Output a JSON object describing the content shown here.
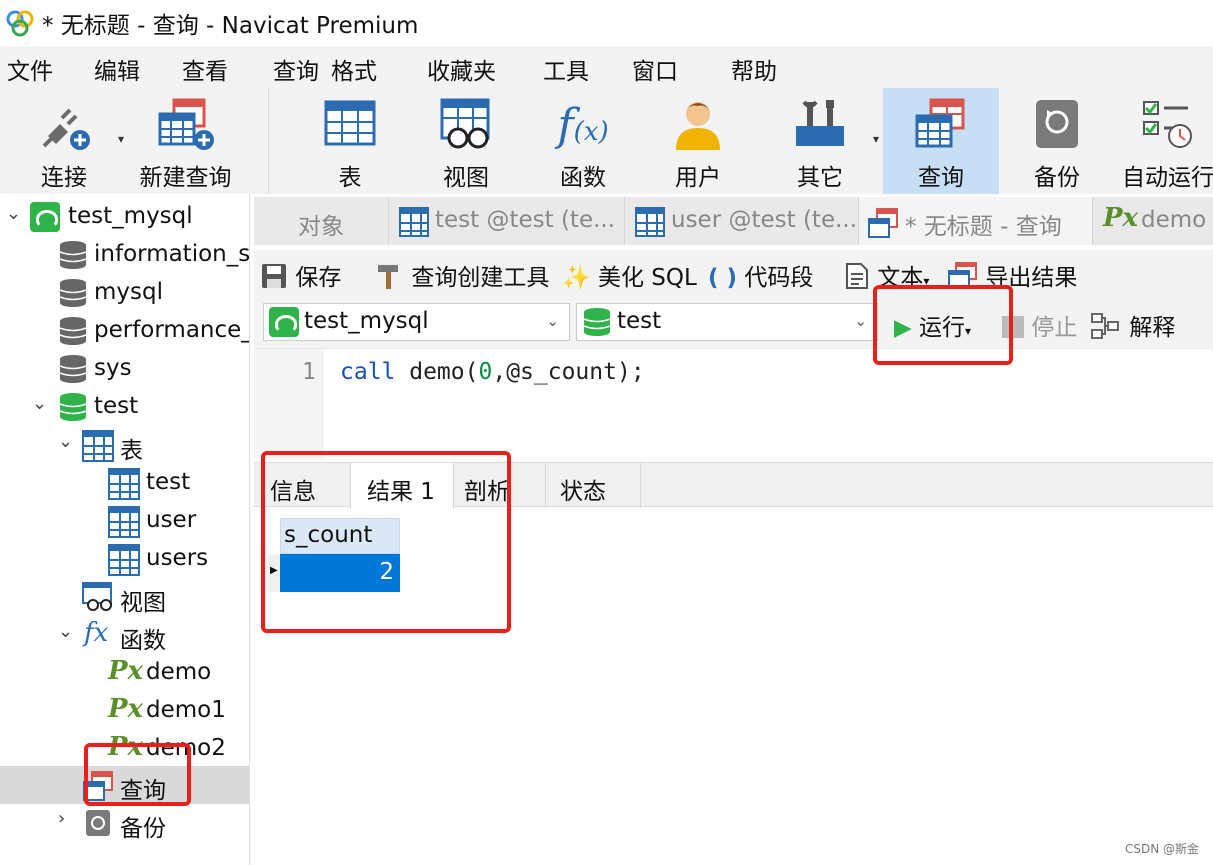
{
  "window": {
    "title": "* 无标题 - 查询 - Navicat Premium"
  },
  "menu": [
    "文件",
    "编辑",
    "查看",
    "查询",
    "格式",
    "收藏夹",
    "工具",
    "窗口",
    "帮助"
  ],
  "toolbar": {
    "connect": "连接",
    "new_query": "新建查询",
    "table": "表",
    "view": "视图",
    "function": "函数",
    "user": "用户",
    "other": "其它",
    "query": "查询",
    "backup": "备份",
    "autorun": "自动运行"
  },
  "sidebar": {
    "connection": "test_mysql",
    "databases": [
      "information_s",
      "mysql",
      "performance_",
      "sys",
      "test"
    ],
    "tables_group": "表",
    "tables": [
      "test",
      "user",
      "users"
    ],
    "views_group": "视图",
    "functions_group": "函数",
    "functions": [
      "demo",
      "demo1",
      "demo2"
    ],
    "queries_group": "查询",
    "backup_group": "备份"
  },
  "tabs": [
    "对象",
    "test @test (te...",
    "user @test (te...",
    "* 无标题 - 查询",
    "demo"
  ],
  "query_toolbar": {
    "save": "保存",
    "builder": "查询创建工具",
    "beautify": "美化 SQL",
    "snippet": "代码段",
    "text": "文本",
    "export": "导出结果",
    "connection_select": "test_mysql",
    "database_select": "test",
    "run": "运行",
    "stop": "停止",
    "explain": "解释"
  },
  "editor": {
    "line_number": "1",
    "code_call": "call",
    "code_fn": " demo(",
    "code_arg0": "0",
    "code_rest": ",@s_count);"
  },
  "results": {
    "tabs": [
      "信息",
      "结果 1",
      "剖析",
      "状态"
    ],
    "active_tab": "结果 1",
    "column": "s_count",
    "value": "2"
  },
  "watermark": "CSDN @斯金",
  "colors": {
    "accent": "#0078d7",
    "highlight": "#e8201c",
    "run_green": "#2fb34a"
  }
}
